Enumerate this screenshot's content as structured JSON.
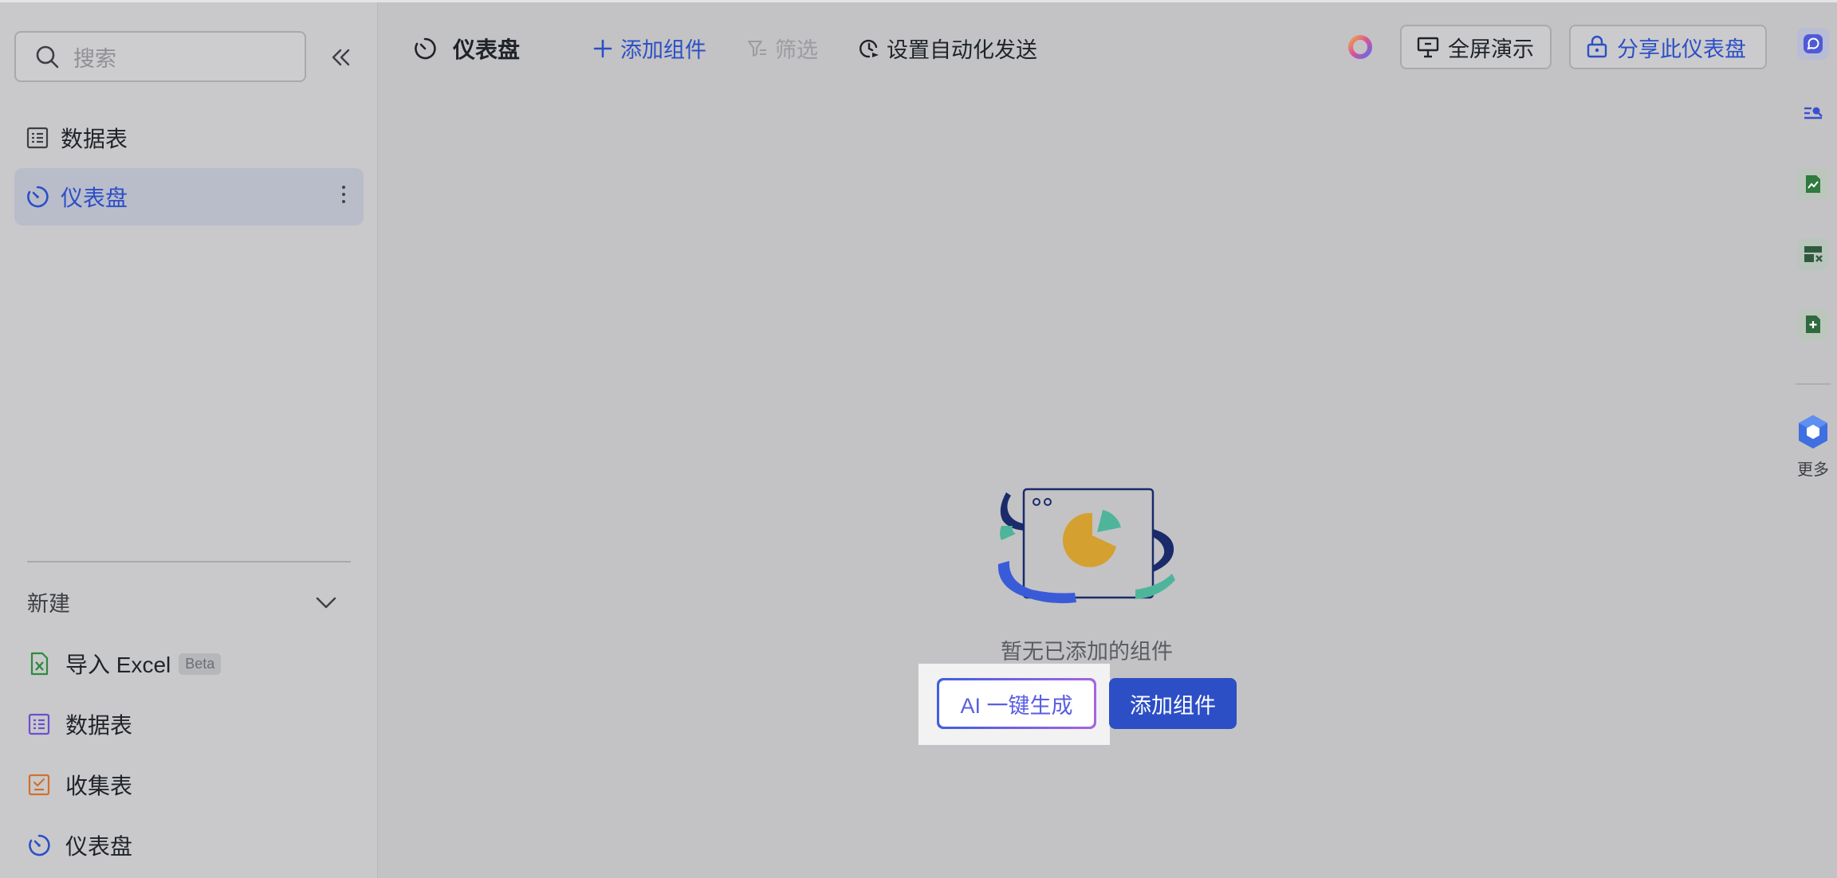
{
  "sidebar": {
    "search_placeholder": "搜索",
    "nav_items": [
      {
        "label": "数据表",
        "icon": "table-icon"
      },
      {
        "label": "仪表盘",
        "icon": "dashboard-icon",
        "active": true
      }
    ],
    "new_section": {
      "title": "新建",
      "items": [
        {
          "label": "导入 Excel",
          "badge": "Beta",
          "icon": "excel-icon"
        },
        {
          "label": "数据表",
          "icon": "table-icon"
        },
        {
          "label": "收集表",
          "icon": "form-icon"
        },
        {
          "label": "仪表盘",
          "icon": "dashboard-icon"
        }
      ]
    }
  },
  "toolbar": {
    "title": "仪表盘",
    "add_component": "添加组件",
    "filter": "筛选",
    "auto_send": "设置自动化发送",
    "present": "全屏演示",
    "share": "分享此仪表盘"
  },
  "rail": {
    "more_label": "更多"
  },
  "empty_state": {
    "message": "暂无已添加的组件",
    "ai_button": "AI 一键生成",
    "add_button": "添加组件"
  },
  "colors": {
    "accent": "#2c4fc6",
    "background": "#c3c3c5",
    "sidebar": "#c9c9cb"
  }
}
